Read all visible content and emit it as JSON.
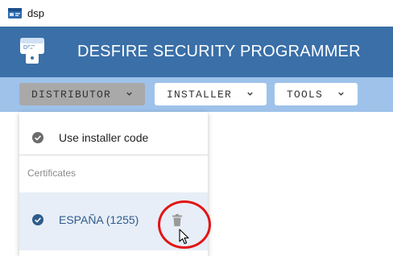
{
  "window": {
    "title": "dsp",
    "icon": "dsp-app-icon"
  },
  "header": {
    "logo_text": "DSP",
    "logo_icon": "lock-card-icon",
    "title": "DESFIRE SECURITY PROGRAMMER",
    "bg_color": "#3a6fa8"
  },
  "toolbar": {
    "bg_color": "#9ec2ea",
    "menus": [
      {
        "label": "DISTRIBUTOR",
        "icon": "chevron-down-icon",
        "active": true
      },
      {
        "label": "INSTALLER",
        "icon": "chevron-down-icon",
        "active": false
      },
      {
        "label": "TOOLS",
        "icon": "chevron-down-icon",
        "active": false
      }
    ]
  },
  "dropdown": {
    "installer_item": {
      "label": "Use installer code",
      "icon": "check-circle-icon"
    },
    "section_label": "Certificates",
    "certificates": [
      {
        "label": "ESPAÑA (1255)",
        "selected": true,
        "icon": "check-circle-icon",
        "action_icon": "trash-icon"
      }
    ]
  },
  "annotation": {
    "highlight_color": "#e31414",
    "cursor_icon": "mouse-pointer-icon"
  }
}
